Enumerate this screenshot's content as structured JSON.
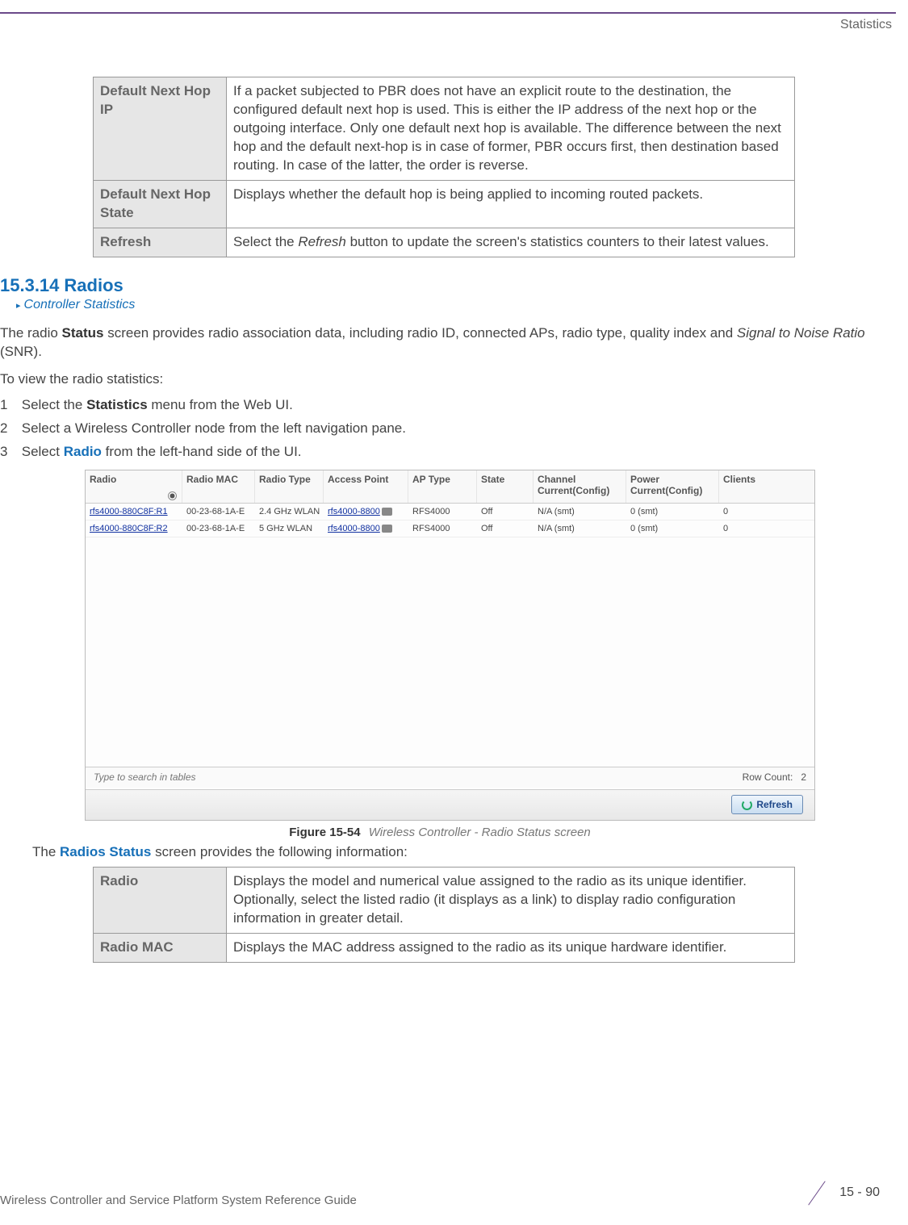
{
  "header": {
    "section_label": "Statistics"
  },
  "table1": {
    "rows": [
      {
        "key": "Default Next Hop IP",
        "val": "If a packet subjected to PBR does not have an explicit route to the destination, the configured default next hop is used. This is either the IP address of the next hop or the outgoing interface. Only one default next hop is available. The difference between the next hop and the default next-hop is in case of former, PBR occurs first, then destination based routing. In case of the latter, the order is reverse."
      },
      {
        "key": "Default Next Hop State",
        "val": "Displays whether the default hop is being applied to incoming routed packets."
      },
      {
        "key": "Refresh",
        "val_pre": "Select the ",
        "val_ital": "Refresh",
        "val_post": " button to update the screen's statistics counters to their latest values."
      }
    ]
  },
  "section": {
    "number": "15.3.14",
    "title": "Radios",
    "breadcrumb": "Controller Statistics"
  },
  "intro": {
    "pre": "The radio ",
    "bold1": "Status",
    "mid": " screen provides radio association data, including radio ID, connected APs, radio type, quality index and ",
    "ital": "Signal to Noise Ratio",
    "post": " (SNR)."
  },
  "lead": "To view the radio statistics:",
  "steps": [
    {
      "n": "1",
      "pre": "Select the ",
      "bold": "Statistics",
      "post": " menu from the Web UI."
    },
    {
      "n": "2",
      "pre": "Select a Wireless Controller node from the left navigation pane.",
      "bold": "",
      "post": ""
    },
    {
      "n": "3",
      "pre": "Select ",
      "bold": "Radio",
      "post": " from the left-hand side of the UI."
    }
  ],
  "screenshot": {
    "headers": [
      "Radio",
      "Radio MAC",
      "Radio Type",
      "Access Point",
      "AP Type",
      "State",
      "Channel Current(Config)",
      "Power Current(Config)",
      "Clients"
    ],
    "rows": [
      {
        "radio": "rfs4000-880C8F:R1",
        "mac": "00-23-68-1A-E",
        "type": "2.4 GHz WLAN",
        "ap": "rfs4000-8800",
        "aptype": "RFS4000",
        "state": "Off",
        "chan": "N/A (smt)",
        "power": "0 (smt)",
        "clients": "0"
      },
      {
        "radio": "rfs4000-880C8F:R2",
        "mac": "00-23-68-1A-E",
        "type": "5 GHz WLAN",
        "ap": "rfs4000-8800",
        "aptype": "RFS4000",
        "state": "Off",
        "chan": "N/A (smt)",
        "power": "0 (smt)",
        "clients": "0"
      }
    ],
    "search_placeholder": "Type to search in tables",
    "row_count_label": "Row Count:",
    "row_count_value": "2",
    "refresh_btn": "Refresh"
  },
  "figure": {
    "label": "Figure 15-54",
    "caption": "Wireless Controller - Radio Status screen"
  },
  "after_fig": {
    "pre": "The ",
    "bold": "Radios Status",
    "post": " screen provides the following information:"
  },
  "table2": {
    "rows": [
      {
        "key": "Radio",
        "val": "Displays the model and numerical value assigned to the radio as its unique identifier. Optionally, select the listed radio (it displays as a link) to display radio configuration information in greater detail."
      },
      {
        "key": "Radio MAC",
        "val": "Displays the MAC address assigned to the radio as its unique hardware identifier."
      }
    ]
  },
  "footer": {
    "guide": "Wireless Controller and Service Platform System Reference Guide",
    "page": "15 - 90"
  }
}
